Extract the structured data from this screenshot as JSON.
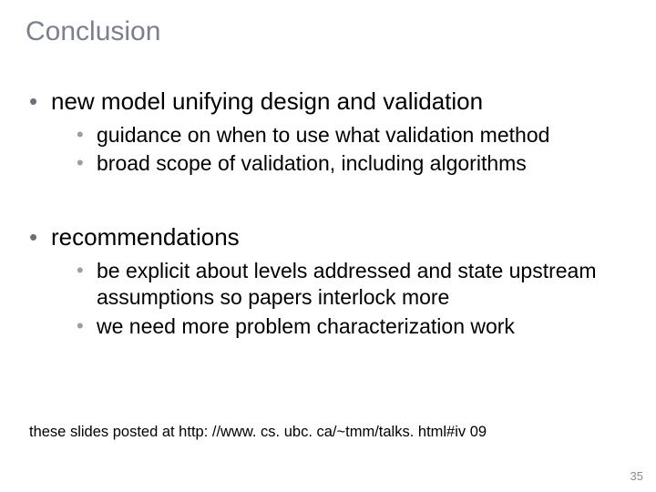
{
  "title": "Conclusion",
  "bullets": {
    "b1": {
      "text": "new model unifying design and validation",
      "sub": {
        "s1": "guidance on when to use what validation method",
        "s2": "broad scope of validation, including algorithms"
      }
    },
    "b2": {
      "text": "recommendations",
      "sub": {
        "s1": "be explicit about levels addressed and state upstream assumptions so papers interlock more",
        "s2": "we need more problem characterization work"
      }
    }
  },
  "footnote": "these slides posted at http: //www. cs. ubc. ca/~tmm/talks. html#iv 09",
  "page_number": "35"
}
